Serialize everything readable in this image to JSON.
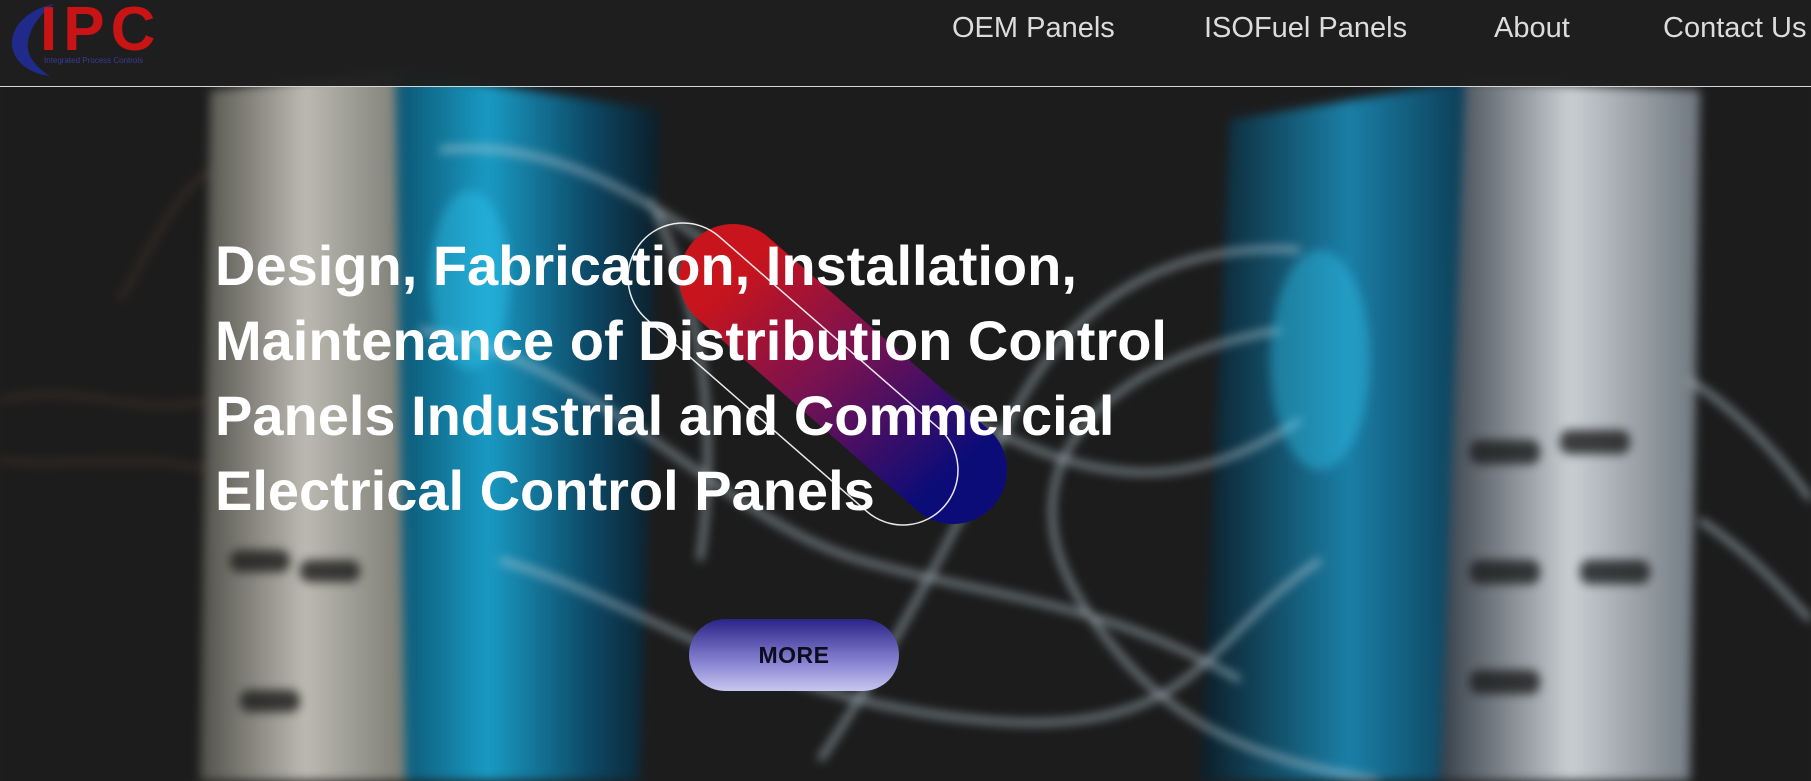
{
  "header": {
    "logo": {
      "text": "IPC",
      "tagline": "Integrated Process Controls"
    },
    "nav": [
      {
        "label": "OEM Panels"
      },
      {
        "label": "ISOFuel Panels"
      },
      {
        "label": "About"
      },
      {
        "label": "Contact Us"
      }
    ]
  },
  "hero": {
    "title_lines": [
      "Design, Fabrication, Installation,",
      "Maintenance of Distribution Control",
      "Panels Industrial and Commercial",
      "Electrical Control Panels"
    ],
    "cta_label": "MORE"
  },
  "colors": {
    "background": "#1e1e1e",
    "logo_red": "#c81414",
    "logo_blue": "#1f2a8a",
    "accent_red": "#c8141c",
    "accent_navy": "#0c0c78",
    "button_top": "#2a2487",
    "button_bottom": "#c9c6ef",
    "nav_text": "#dcdcdc",
    "hero_text": "#ffffff"
  }
}
